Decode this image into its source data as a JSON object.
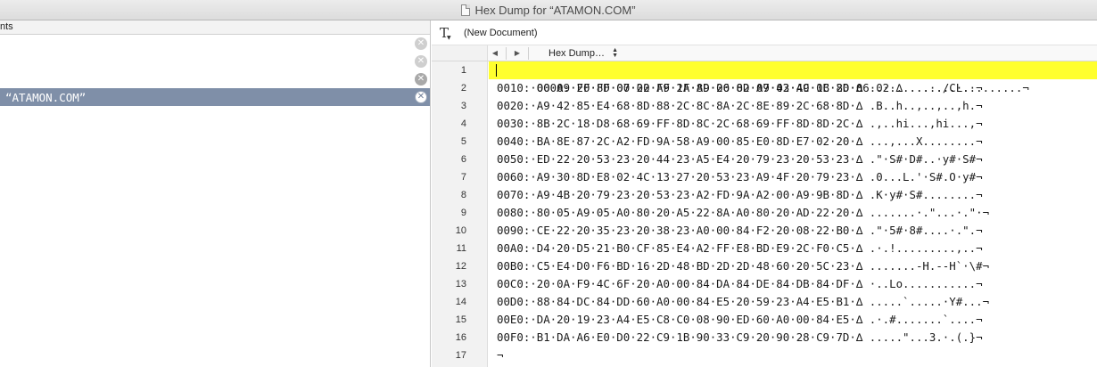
{
  "window": {
    "title": "Hex Dump for “ATAMON.COM”"
  },
  "left_pane": {
    "header": "nts",
    "rows": [
      {
        "label": "",
        "selected": false
      },
      {
        "label": "",
        "selected": false
      },
      {
        "label": "",
        "selected": false
      },
      {
        "label": "“ATAMON.COM”",
        "selected": true
      }
    ]
  },
  "editor": {
    "document_name": "(New Document)",
    "nav_back": "◀",
    "nav_forward": "▶",
    "mode_popup": "Hex Dump…",
    "line_numbers": [
      "1",
      "2",
      "3",
      "4",
      "5",
      "6",
      "7",
      "8",
      "9",
      "10",
      "11",
      "12",
      "13",
      "14",
      "15",
      "16",
      "17"
    ],
    "lines": [
      "0000:·FF·FF·00·20·FF·2F·A9·20·8D·07·02·A9·0B·8D·06·02·∆ ...·./.·.........¬",
      "0010:·00·A9·20·8D·07·02·A9·1A·8D·06·02·A9·43·4C·1C·20·∆ ..·.........CL.·¬",
      "0020:·A9·42·85·E4·68·8D·88·2C·8C·8A·2C·8E·89·2C·68·8D·∆ .B..h..,..,..,h.¬",
      "0030:·8B·2C·18·D8·68·69·FF·8D·8C·2C·68·69·FF·8D·8D·2C·∆ .,..hi...,hi...,¬",
      "0040:·BA·8E·87·2C·A2·FD·9A·58·A9·00·85·E0·8D·E7·02·20·∆ ...,...X........¬",
      "0050:·ED·22·20·53·23·20·44·23·A5·E4·20·79·23·20·53·23·∆ .\"·S#·D#..·y#·S#¬",
      "0060:·A9·30·8D·E8·02·4C·13·27·20·53·23·A9·4F·20·79·23·∆ .0...L.'·S#.O·y#¬",
      "0070:·A9·4B·20·79·23·20·53·23·A2·FD·9A·A2·00·A9·9B·8D·∆ .K·y#·S#........¬",
      "0080:·80·05·A9·05·A0·80·20·A5·22·8A·A0·80·20·AD·22·20·∆ .......·.\"...·.\"·¬",
      "0090:·CE·22·20·35·23·20·38·23·A0·00·84·F2·20·08·22·B0·∆ .\"·5#·8#....·.\".¬",
      "00A0:·D4·20·D5·21·B0·CF·85·E4·A2·FF·E8·BD·E9·2C·F0·C5·∆ .·.!.........,..¬",
      "00B0:·C5·E4·D0·F6·BD·16·2D·48·BD·2D·2D·48·60·20·5C·23·∆ .......-H.--H`·\\#¬",
      "00C0:·20·0A·F9·4C·6F·20·A0·00·84·DA·84·DE·84·DB·84·DF·∆ ·..Lo...........¬",
      "00D0:·88·84·DC·84·DD·60·A0·00·84·E5·20·59·23·A4·E5·B1·∆ .....`.....·Y#...¬",
      "00E0:·DA·20·19·23·A4·E5·C8·C0·08·90·ED·60·A0·00·84·E5·∆ .·.#.......`....¬",
      "00F0:·B1·DA·A6·E0·D0·22·C9·1B·90·33·C9·20·90·28·C9·7D·∆ .....\"...3.·.(.}¬",
      "¬"
    ]
  },
  "colors": {
    "highlight": "#ffff2e",
    "selection": "#7f8fa8"
  }
}
